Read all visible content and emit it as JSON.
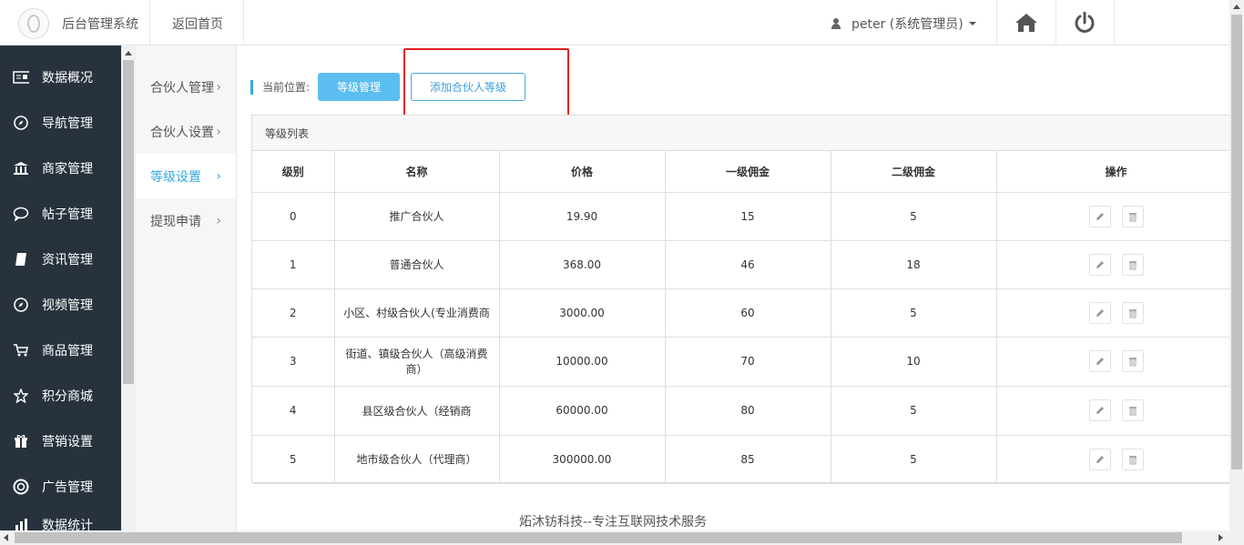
{
  "header": {
    "app_title": "后台管理系统",
    "back_home": "返回首页",
    "user_label": "peter (系统管理员)"
  },
  "sidebar": {
    "items": [
      {
        "label": "数据概况",
        "icon": "dashboard-icon"
      },
      {
        "label": "导航管理",
        "icon": "compass-icon"
      },
      {
        "label": "商家管理",
        "icon": "bank-icon"
      },
      {
        "label": "帖子管理",
        "icon": "chat-icon"
      },
      {
        "label": "资讯管理",
        "icon": "book-icon"
      },
      {
        "label": "视频管理",
        "icon": "video-icon"
      },
      {
        "label": "商品管理",
        "icon": "cart-icon"
      },
      {
        "label": "积分商城",
        "icon": "star-icon"
      },
      {
        "label": "营销设置",
        "icon": "gift-icon"
      },
      {
        "label": "广告管理",
        "icon": "lifebuoy-icon"
      },
      {
        "label": "数据统计",
        "icon": "chart-icon"
      }
    ]
  },
  "subnav": {
    "items": [
      {
        "label": "合伙人管理"
      },
      {
        "label": "合伙人设置"
      },
      {
        "label": "等级设置"
      },
      {
        "label": "提现申请"
      }
    ],
    "active": "等级设置",
    "chevron": "›"
  },
  "breadcrumb": {
    "label": "当前位置:",
    "current_button": "等级管理",
    "add_button": "添加合伙人等级"
  },
  "panel": {
    "title": "等级列表",
    "columns": [
      "级别",
      "名称",
      "价格",
      "一级佣金",
      "二级佣金",
      "操作"
    ],
    "rows": [
      {
        "level": "0",
        "name": "推广合伙人",
        "price": "19.90",
        "c1": "15",
        "c2": "5"
      },
      {
        "level": "1",
        "name": "普通合伙人",
        "price": "368.00",
        "c1": "46",
        "c2": "18"
      },
      {
        "level": "2",
        "name": "小区、村级合伙人(专业消费商",
        "price": "3000.00",
        "c1": "60",
        "c2": "5"
      },
      {
        "level": "3",
        "name": "街道、镇级合伙人（高级消费商）",
        "price": "10000.00",
        "c1": "70",
        "c2": "10"
      },
      {
        "level": "4",
        "name": "县区级合伙人（经销商",
        "price": "60000.00",
        "c1": "80",
        "c2": "5"
      },
      {
        "level": "5",
        "name": "地市级合伙人（代理商）",
        "price": "300000.00",
        "c1": "85",
        "c2": "5"
      }
    ]
  },
  "footer": {
    "text": "炻沐钫科技--专注互联网技术服务"
  },
  "colors": {
    "sidebar_bg": "#27323d",
    "accent": "#36a9e1",
    "highlight": "#e21d1d"
  }
}
